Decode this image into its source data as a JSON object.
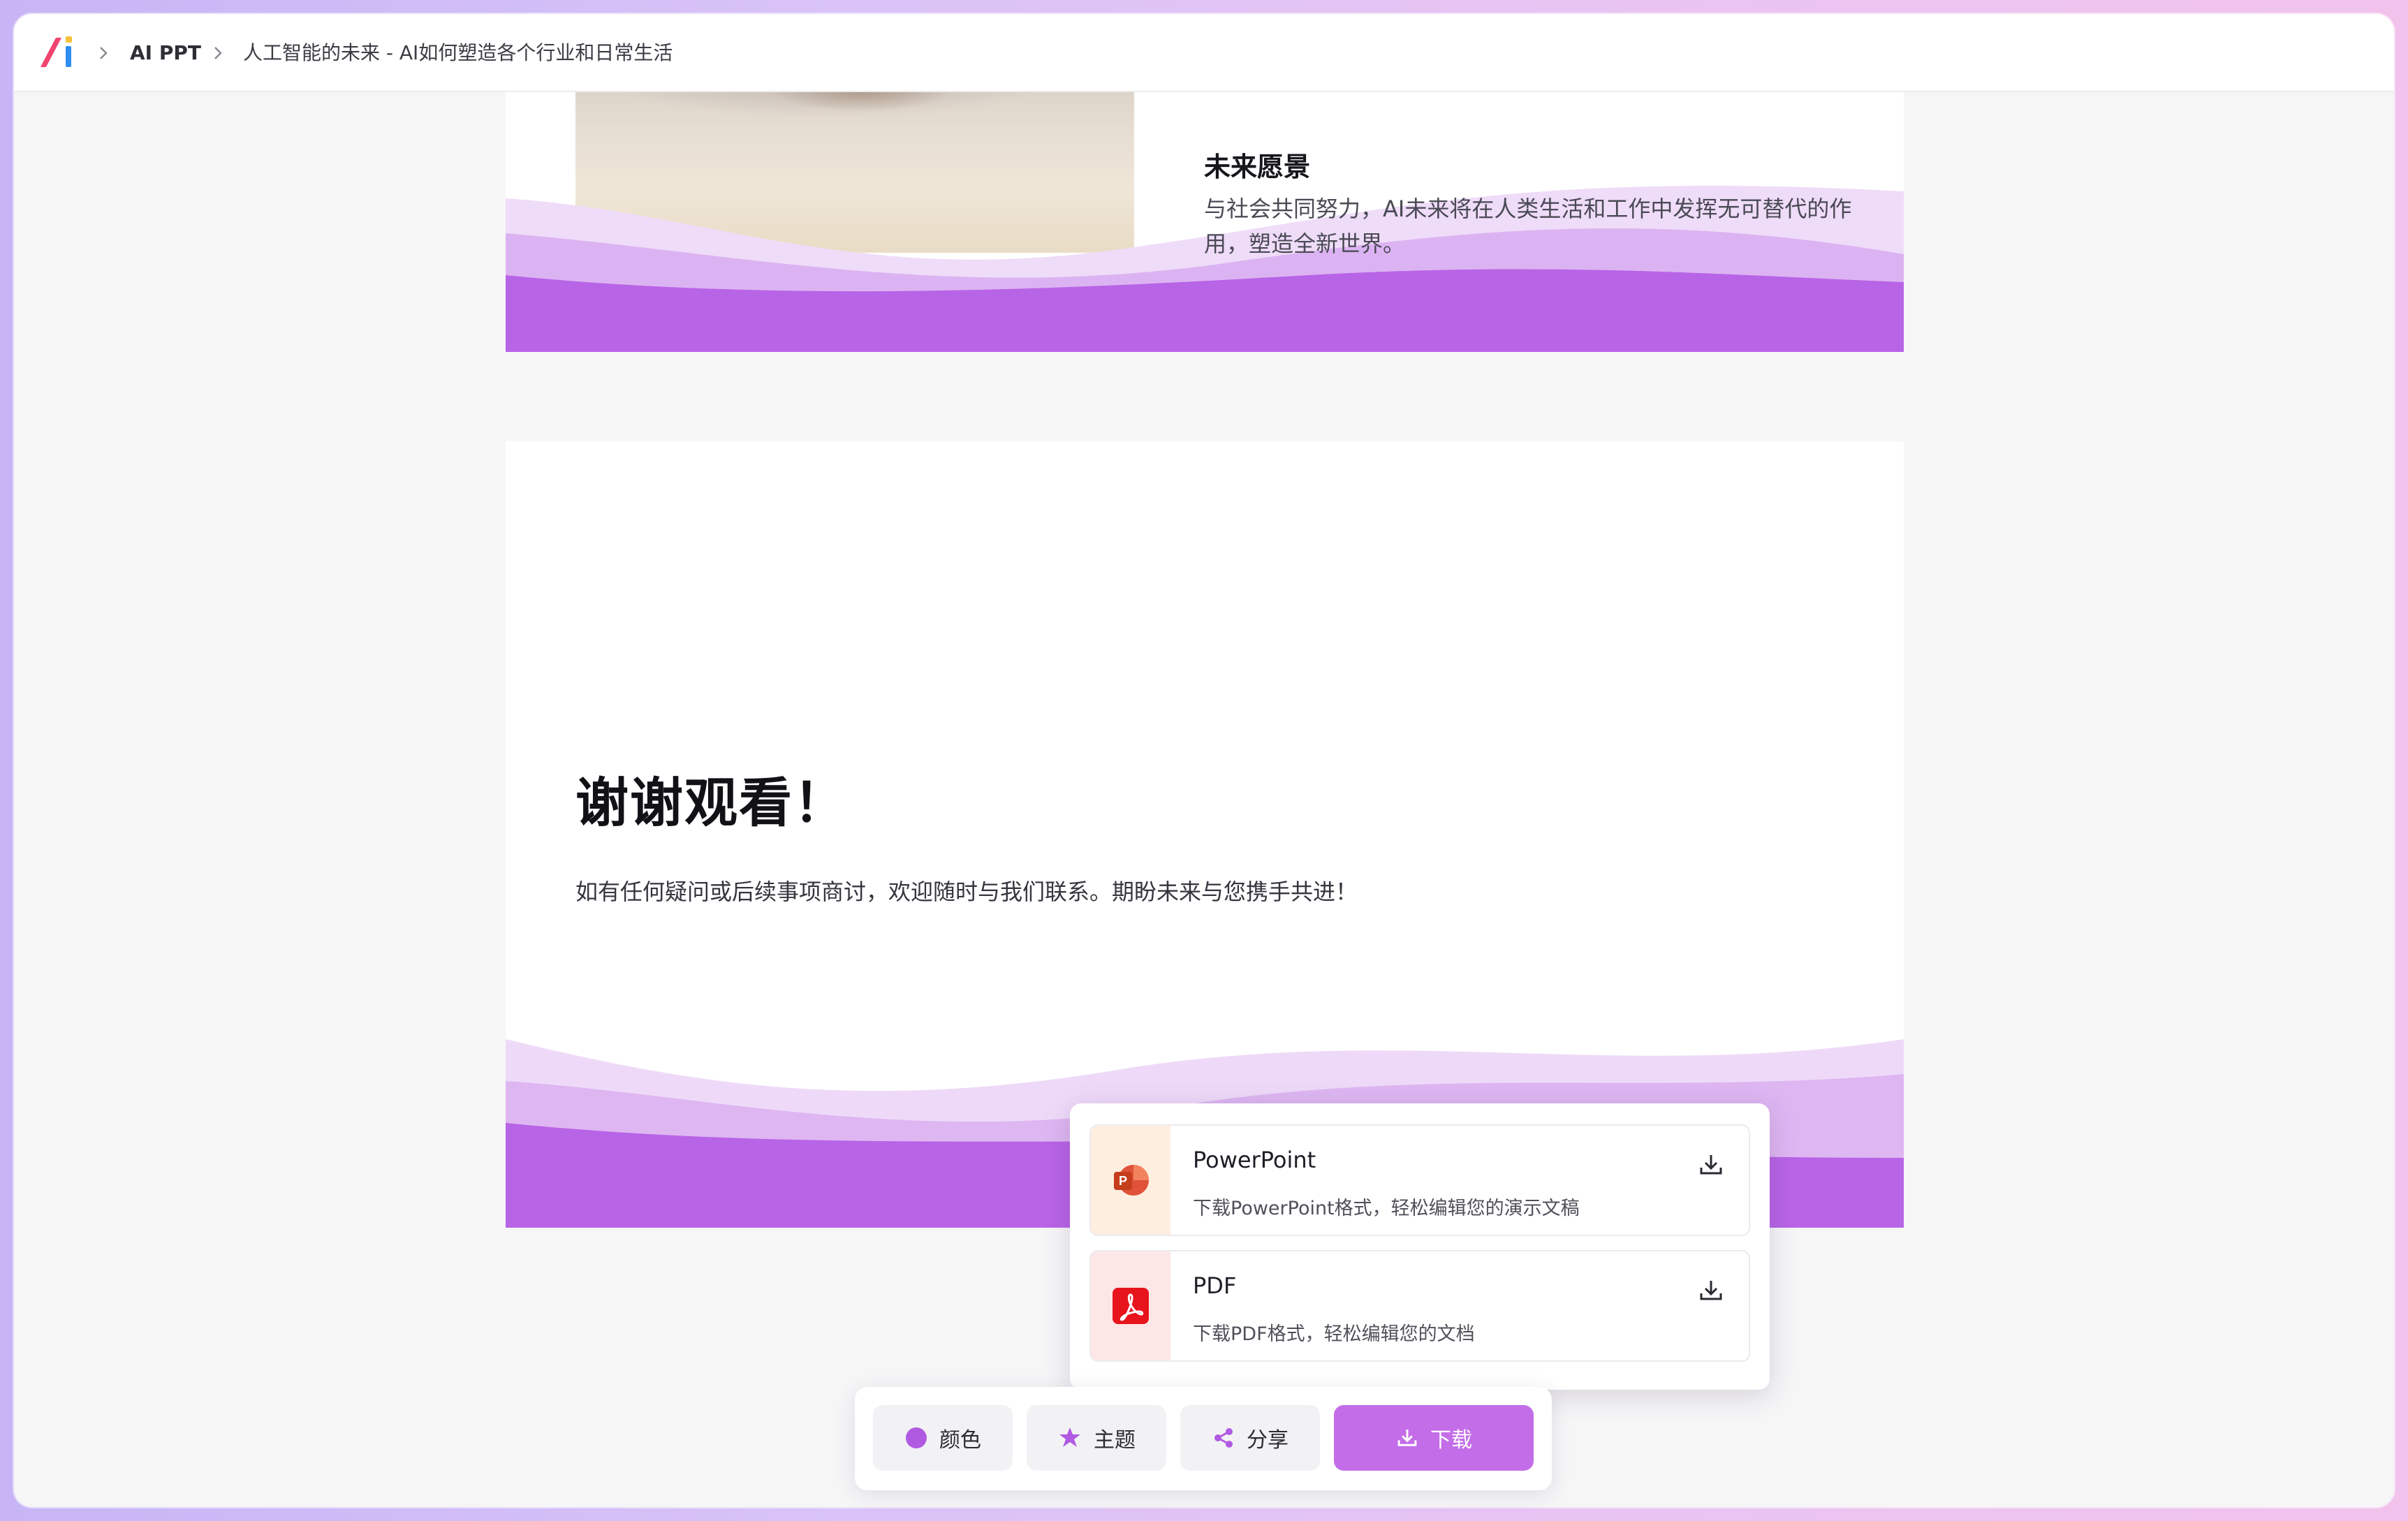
{
  "breadcrumb": {
    "app": "AI PPT",
    "document": "人工智能的未来 - AI如何塑造各个行业和日常生活"
  },
  "slide1": {
    "heading": "未来愿景",
    "body": "与社会共同努力，AI未来将在人类生活和工作中发挥无可替代的作用，塑造全新世界。"
  },
  "slide2": {
    "title": "谢谢观看！",
    "body": "如有任何疑问或后续事项商讨，欢迎随时与我们联系。期盼未来与您携手共进！"
  },
  "download_menu": {
    "options": [
      {
        "title": "PowerPoint",
        "desc": "下载PowerPoint格式，轻松编辑您的演示文稿",
        "icon": "powerpoint-icon"
      },
      {
        "title": "PDF",
        "desc": "下载PDF格式，轻松编辑您的文档",
        "icon": "pdf-icon"
      }
    ]
  },
  "toolbar": {
    "color_label": "颜色",
    "theme_label": "主题",
    "share_label": "分享",
    "download_label": "下载"
  },
  "colors": {
    "accent": "#c36de8",
    "wave_dark": "#b562e4",
    "wave_light": "#e6c6f5"
  }
}
